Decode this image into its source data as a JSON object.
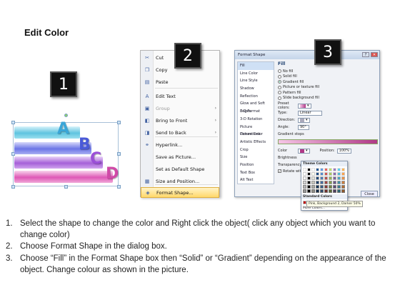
{
  "title": "Edit Color",
  "badges": [
    "1",
    "2",
    "3"
  ],
  "shape_letters": [
    "A",
    "B",
    "C",
    "D"
  ],
  "menu": {
    "items": [
      {
        "icon": "scissors-icon",
        "glyph": "✂",
        "label": "Cut"
      },
      {
        "icon": "copy-icon",
        "glyph": "❐",
        "label": "Copy"
      },
      {
        "icon": "paste-icon",
        "glyph": "▤",
        "label": "Paste"
      },
      {
        "icon": "edit-text-icon",
        "glyph": "A",
        "label": "Edit Text"
      },
      {
        "icon": "group-icon",
        "glyph": "▣",
        "label": "Group",
        "disabled": true,
        "submenu": true
      },
      {
        "icon": "bring-front-icon",
        "glyph": "◧",
        "label": "Bring to Front",
        "submenu": true
      },
      {
        "icon": "send-back-icon",
        "glyph": "◨",
        "label": "Send to Back",
        "submenu": true
      },
      {
        "icon": "hyperlink-icon",
        "glyph": "⚭",
        "label": "Hyperlink..."
      },
      {
        "icon": "",
        "glyph": "",
        "label": "Save as Picture..."
      },
      {
        "icon": "",
        "glyph": "",
        "label": "Set as Default Shape"
      },
      {
        "icon": "size-icon",
        "glyph": "▦",
        "label": "Size and Position..."
      },
      {
        "icon": "format-shape-icon",
        "glyph": "◈",
        "label": "Format Shape...",
        "highlighted": true
      }
    ]
  },
  "dialog": {
    "title": "Format Shape",
    "nav": [
      "Fill",
      "Line Color",
      "Line Style",
      "Shadow",
      "Reflection",
      "Glow and Soft Edges",
      "3-D Format",
      "3-D Rotation",
      "Picture Corrections",
      "Picture Color",
      "Artistic Effects",
      "Crop",
      "Size",
      "Position",
      "Text Box",
      "Alt Text"
    ],
    "fill_header": "Fill",
    "fill_options": [
      "No fill",
      "Solid fill",
      "Gradient fill",
      "Picture or texture fill",
      "Pattern fill",
      "Slide background fill"
    ],
    "fields": {
      "preset_label": "Preset colors:",
      "type_label": "Type:",
      "type_value": "Linear",
      "direction_label": "Direction:",
      "angle_label": "Angle:",
      "angle_value": "90°",
      "gradient_stops_label": "Gradient stops",
      "color_label": "Color",
      "position_label": "Position:",
      "position_value": "100%",
      "brightness_label": "Brightness",
      "transparency_label": "Transparency",
      "rotate_label": "Rotate with shape"
    },
    "palette": {
      "theme_title": "Theme Colors",
      "standard_title": "Standard Colors",
      "more_label": "More Colors...",
      "tooltip": "Pink, Background 2, Darker 50%"
    },
    "close_label": "Close"
  },
  "steps": [
    {
      "n": "1.",
      "text": "Select the shape to change the color and Right click the object( click any object which you want to change color)"
    },
    {
      "n": "2.",
      "text": "Choose Format Shape in the dialog box."
    },
    {
      "n": "3.",
      "text": "Choose “Fill” in the Format Shape box then “Solid” or “Gradient” depending on the appearance of the object. Change colour as shown in the picture."
    }
  ]
}
